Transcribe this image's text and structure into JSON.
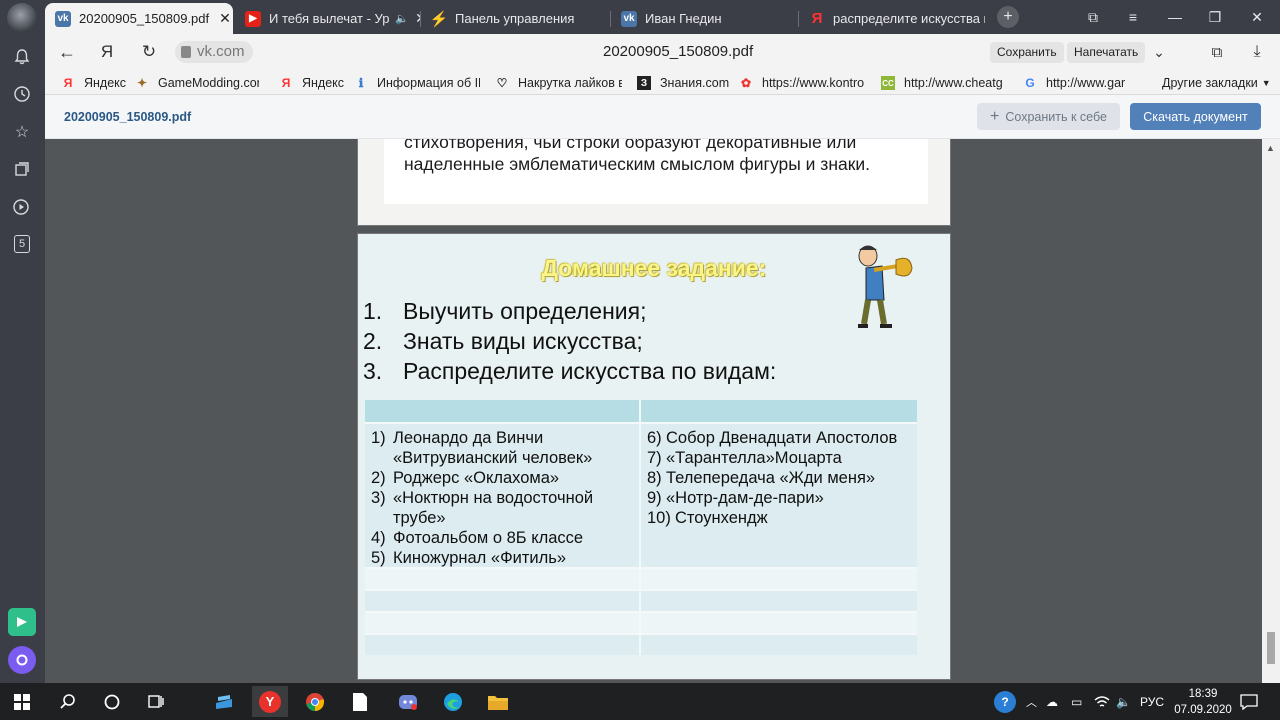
{
  "browser": {
    "tabs": [
      {
        "title": "20200905_150809.pdf",
        "icon": "vk-icon",
        "active": true
      },
      {
        "title": "И тебя вылечат - Ур",
        "icon": "youtube-icon"
      },
      {
        "title": "Панель управления",
        "icon": "panel-icon"
      },
      {
        "title": "Иван Гнедин",
        "icon": "vk-icon"
      },
      {
        "title": "распределите искусства п",
        "icon": "yandex-icon"
      }
    ],
    "domain": "vk.com",
    "page_title": "20200905_150809.pdf",
    "save_label": "Сохранить",
    "print_label": "Напечатать",
    "sidebar_badge": "5",
    "bookmarks": [
      {
        "label": "Яндекс",
        "icon": "yandex-icon"
      },
      {
        "label": "GameModding.com",
        "icon": "gamemodding-icon"
      },
      {
        "label": "Яндекс",
        "icon": "yandex-icon"
      },
      {
        "label": "Информация об IP",
        "icon": "info-icon"
      },
      {
        "label": "Накрутка лайков в",
        "icon": "heart-icon"
      },
      {
        "label": "Знания.com",
        "icon": "znania-icon"
      },
      {
        "label": "https://www.kontro",
        "icon": "kontro-icon"
      },
      {
        "label": "http://www.cheatg",
        "icon": "cheat-icon"
      },
      {
        "label": "http://www.gar",
        "icon": "google-icon"
      }
    ],
    "other_bookmarks": "Другие закладки"
  },
  "viewer": {
    "file_name": "20200905_150809.pdf",
    "save_to_me": "Сохранить к себе",
    "download": "Скачать документ"
  },
  "doc": {
    "prev_text": "стихотворения, чьи строки образуют декоративные или наделенные эмблематическим смыслом фигуры и знаки.",
    "homework_title": "Домашнее задание:",
    "tasks": [
      {
        "n": "1.",
        "text": "Выучить  определения;"
      },
      {
        "n": "2.",
        "text": "Знать виды искусства;"
      },
      {
        "n": "3.",
        "text": "Распределите искусства по видам:"
      }
    ],
    "left_items": [
      {
        "n": "1)",
        "text": "Леонардо да Винчи «Витрувианский человек»"
      },
      {
        "n": "2)",
        "text": "Роджерс «Оклахома»"
      },
      {
        "n": "3)",
        "text": "«Ноктюрн на водосточной трубе»"
      },
      {
        "n": "4)",
        "text": "Фотоальбом о 8Б классе"
      },
      {
        "n": "5)",
        "text": "Киножурнал «Фитиль»"
      }
    ],
    "right_items": [
      {
        "n": "6)",
        "text": "Собор Двенадцати Апостолов"
      },
      {
        "n": "7)",
        "text": "«Тарантелла»Моцарта"
      },
      {
        "n": "8)",
        "text": "Телепередача «Жди меня»"
      },
      {
        "n": "9)",
        "text": "«Нотр-дам-де-пари»"
      },
      {
        "n": "10)",
        "text": "Стоунхендж"
      }
    ]
  },
  "taskbar": {
    "lang": "РУС",
    "time": "18:39",
    "date": "07.09.2020"
  }
}
